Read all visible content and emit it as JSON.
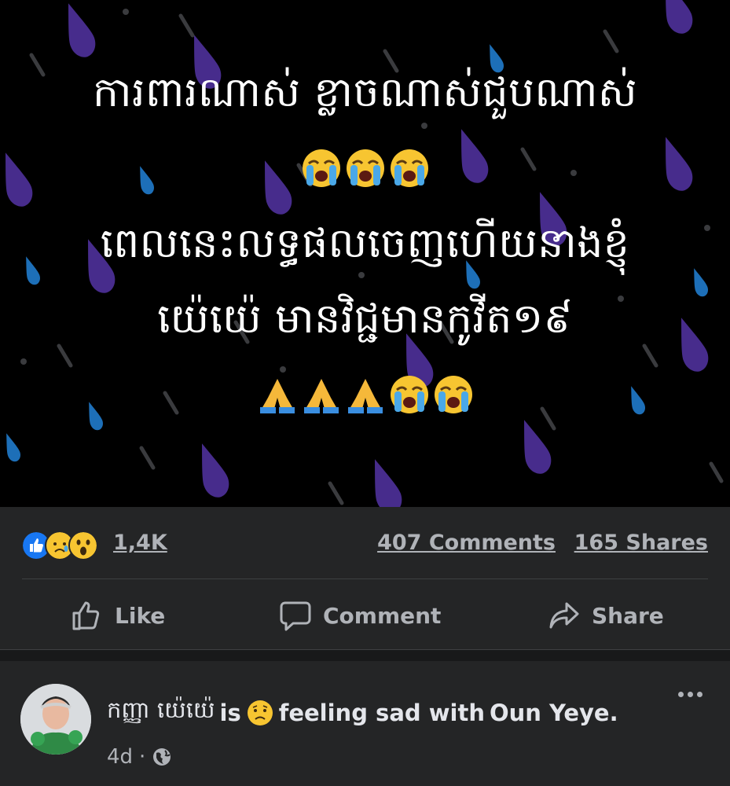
{
  "post": {
    "text_lines": [
      "ការពារណាស់ ខ្លាចណាស់ជួបណាស់",
      "ពេលនេះលទ្ធផលចេញហើយនាងខ្ញុំ",
      "យ៉េយ៉េ មានវិជ្ជមានកូវីត១៩"
    ],
    "emoji_row_1": [
      "crying-face",
      "crying-face",
      "crying-face"
    ],
    "emoji_row_2": [
      "folded-hands",
      "folded-hands",
      "folded-hands",
      "crying-face",
      "crying-face"
    ]
  },
  "stats": {
    "reactions": [
      "like",
      "sad",
      "wow"
    ],
    "reaction_count": "1,4K",
    "comments": "407 Comments",
    "shares": "165 Shares"
  },
  "actions": {
    "like": "Like",
    "comment": "Comment",
    "share": "Share"
  },
  "next_post": {
    "author": "កញ្ញា យ៉េយ៉េ",
    "is": "is",
    "feeling": "feeling sad with",
    "tagged": "Oun Yeye.",
    "time": "4d",
    "separator": "·",
    "privacy": "globe-icon"
  },
  "colors": {
    "background": "#242526",
    "like_blue": "#1877f2",
    "muted_text": "#b0b3b8",
    "rain_purple": "#5b3fa8",
    "rain_blue": "#1d6fb8"
  }
}
